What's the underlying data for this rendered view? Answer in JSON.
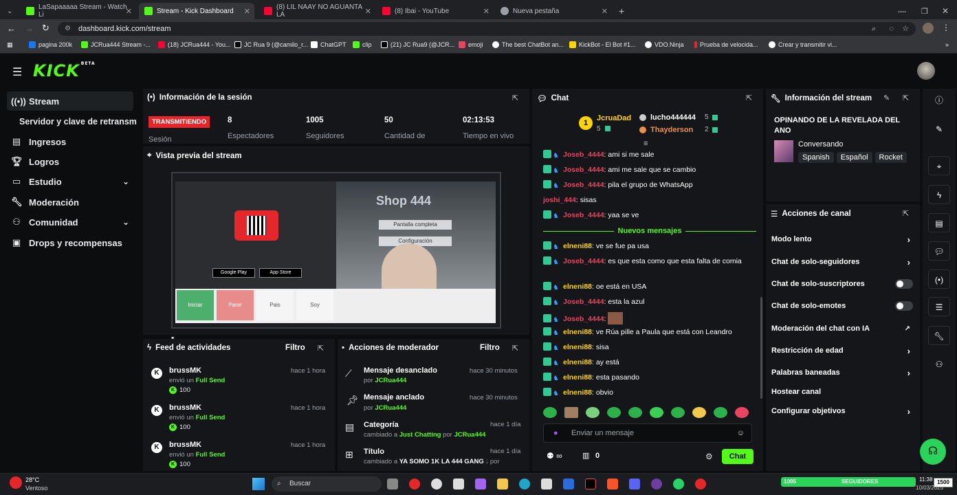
{
  "browser": {
    "tabs": [
      {
        "title": "LaSapaaaaa Stream - Watch Li",
        "color": "#53fc18"
      },
      {
        "title": "Stream - Kick Dashboard",
        "color": "#53fc18"
      },
      {
        "title": "(8) LIL NAAY NO AGUANTA LA",
        "color": "#ff0033"
      },
      {
        "title": "(8) Ibai - YouTube",
        "color": "#ff0033"
      },
      {
        "title": "Nueva pestaña",
        "color": "#9aa0a6"
      }
    ],
    "url": "dashboard.kick.com/stream",
    "bookmarks": [
      {
        "label": "pagina 200k",
        "color": "#1877f2"
      },
      {
        "label": "JCRua444 Stream -...",
        "color": "#53fc18"
      },
      {
        "label": "(18) JCRua444 - You...",
        "color": "#ff0033"
      },
      {
        "label": "JC Rua 9 (@camilo_r...",
        "color": "#000000"
      },
      {
        "label": "ChatGPT",
        "color": "#ffffff"
      },
      {
        "label": "clip",
        "color": "#53fc18"
      },
      {
        "label": "(21) JC Rua9 (@JCR...",
        "color": "#000000"
      },
      {
        "label": "emoji",
        "color": "#e94560"
      },
      {
        "label": "The best ChatBot an...",
        "color": "#ffffff"
      },
      {
        "label": "KickBot - El Bot #1...",
        "color": "#ffd400"
      },
      {
        "label": "VDO.Ninja",
        "color": "#ffffff"
      },
      {
        "label": "Prueba de velocida...",
        "color": "#e5262a"
      },
      {
        "label": "Crear y transmitir vi...",
        "color": "#ffffff"
      }
    ]
  },
  "kick": {
    "logo": "KICK",
    "logo_beta": "BETA",
    "accent": "#53fc18"
  },
  "sidebar": {
    "items": [
      {
        "label": "Stream",
        "icon": "broadcast-icon"
      },
      {
        "label": "Servidor y clave de retransm",
        "icon": ""
      },
      {
        "label": "Ingresos",
        "icon": "chart-icon"
      },
      {
        "label": "Logros",
        "icon": "trophy-icon"
      },
      {
        "label": "Estudio",
        "icon": "studio-icon"
      },
      {
        "label": "Moderación",
        "icon": "wrench-icon"
      },
      {
        "label": "Comunidad",
        "icon": "users-icon"
      },
      {
        "label": "Drops y recompensas",
        "icon": "gift-icon"
      }
    ]
  },
  "session": {
    "title": "Información de la sesión",
    "status": "TRANSMITIENDO",
    "status_label": "Sesión",
    "stats": [
      {
        "value": "8",
        "label": "Espectadores"
      },
      {
        "value": "1005",
        "label": "Seguidores"
      },
      {
        "value": "50",
        "label": "Cantidad de"
      },
      {
        "value": "02:13:53",
        "label": "Tiempo en vivo"
      }
    ]
  },
  "preview": {
    "title": "Vista previa del stream",
    "overlay_title": "Shop 444",
    "btn_full": "Pantalla completa",
    "btn_config": "Configuración",
    "google_play": "Google Play",
    "app_store": "App Store",
    "cards": [
      "Iniciar",
      "Parar",
      "Pais",
      "Soy"
    ]
  },
  "feed": {
    "title": "Feed de actividades",
    "filter": "Filtro",
    "items": [
      {
        "user": "brussMK",
        "action": "envió un",
        "item": "Full Send",
        "amount": "100",
        "time": "hace 1 hora"
      },
      {
        "user": "brussMK",
        "action": "envió un",
        "item": "Full Send",
        "amount": "100",
        "time": "hace 1 hora"
      },
      {
        "user": "brussMK",
        "action": "envió un",
        "item": "Full Send",
        "amount": "100",
        "time": "hace 1 hora"
      }
    ]
  },
  "mod_actions": {
    "title": "Acciones de moderador",
    "filter": "Filtro",
    "items": [
      {
        "title": "Mensaje desanclado",
        "by": "por",
        "user": "JCRua444",
        "time": "hace 30 minutos"
      },
      {
        "title": "Mensaje anclado",
        "by": "por",
        "user": "JCRua444",
        "time": "hace 30 minutos"
      },
      {
        "title": "Categoría",
        "line": "cambiado a",
        "value": "Just Chatting",
        "by": "por",
        "user": "JCRua444",
        "time": "hace 1 día"
      },
      {
        "title": "Título",
        "line": "cambiado a",
        "value": "YA SOMO 1K LA 444 GANG",
        "by": "por",
        "time": "hace 1 día"
      }
    ]
  },
  "chat": {
    "title": "Chat",
    "leaders": [
      {
        "name": "JcruaDad",
        "count": "5",
        "rank": "1"
      },
      {
        "name": "lucho444444",
        "count": "5"
      },
      {
        "name": "Thayderson",
        "count": "2"
      }
    ],
    "new_messages": "Nuevos mensajes",
    "messages": [
      {
        "user": "Joseb_4444",
        "style": "u2",
        "text": "ami si me sale"
      },
      {
        "user": "Joseb_4444",
        "style": "u2",
        "text": "ami me sale que se cambio"
      },
      {
        "user": "Joseb_4444",
        "style": "u2",
        "text": "pila el grupo de WhatsApp"
      },
      {
        "user": "joshi_444",
        "style": "u2",
        "text": "sisas",
        "nobadge": true
      },
      {
        "user": "Joseb_4444",
        "style": "u2",
        "text": "yaa se ve"
      },
      {
        "user": "elneni88",
        "style": "u3",
        "text": "ve se fue pa usa"
      },
      {
        "user": "Joseb_4444",
        "style": "u2",
        "text": "es que esta como que esta falta de comia"
      },
      {
        "user": "elneni88",
        "style": "u3",
        "text": "oe está en USA"
      },
      {
        "user": "Joseb_4444",
        "style": "u2",
        "text": "esta la azul"
      },
      {
        "user": "Joseb_4444",
        "style": "u2",
        "text": ""
      },
      {
        "user": "elneni88",
        "style": "u3",
        "text": "ve Rúa pille a Paula que está con Leandro"
      },
      {
        "user": "elneni88",
        "style": "u3",
        "text": "sisa"
      },
      {
        "user": "elneni88",
        "style": "u3",
        "text": "ay está"
      },
      {
        "user": "elneni88",
        "style": "u3",
        "text": "esta pasando"
      },
      {
        "user": "elneni88",
        "style": "u3",
        "text": "obvio"
      }
    ],
    "input_placeholder": "Enviar un mensaje",
    "send_label": "Chat",
    "points": "0"
  },
  "stream_info": {
    "title": "Información del stream",
    "stream_title": "OPINANDO DE LA REVELADA DEL ANO",
    "category": "Conversando",
    "tags": [
      "Spanish",
      "Español",
      "Rocket"
    ]
  },
  "channel_actions": {
    "title": "Acciones de canal",
    "items": [
      {
        "label": "Modo lento",
        "control": "arrow"
      },
      {
        "label": "Chat de solo-seguidores",
        "control": "arrow"
      },
      {
        "label": "Chat de solo-suscriptores",
        "control": "toggle"
      },
      {
        "label": "Chat de solo-emotes",
        "control": "toggle"
      },
      {
        "label": "Moderación del chat con IA",
        "control": "link"
      },
      {
        "label": "Restricción de edad",
        "control": "arrow"
      },
      {
        "label": "Palabras baneadas",
        "control": "arrow"
      },
      {
        "label": "Hostear canal",
        "control": "none"
      },
      {
        "label": "Configurar objetivos",
        "control": "arrow"
      }
    ]
  },
  "taskbar": {
    "weather_temp": "28°C",
    "weather_desc": "Ventoso",
    "search": "Buscar",
    "followers_count": "1005",
    "followers_label": "SEGUIDORES",
    "time": "11:38",
    "date": "10/03/2025",
    "counter": "1500"
  }
}
